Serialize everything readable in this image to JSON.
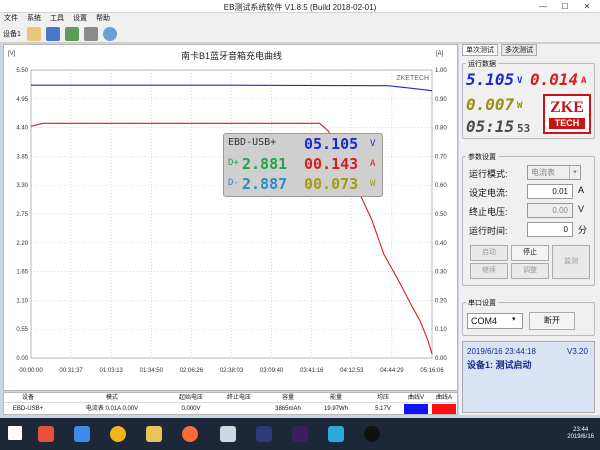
{
  "window": {
    "title": "EB测试系统软件 V1.8.5 (Build 2018-02-01)",
    "minimize": "—",
    "maximize": "☐",
    "close": "✕"
  },
  "menu": [
    "文件",
    "系统",
    "工具",
    "设置",
    "帮助"
  ],
  "toolbar": {
    "device_label": "设备1",
    "icons": [
      "folder-icon",
      "save-icon",
      "image-icon",
      "tools-icon",
      "search-icon"
    ]
  },
  "chart_data": {
    "type": "line",
    "title": "南卡B1蓝牙音箱充电曲线",
    "watermark": "ZKETECH",
    "left_unit": "[V]",
    "right_unit": "[A]",
    "y_left_ticks": [
      "5.50",
      "4.95",
      "4.40",
      "3.85",
      "3.30",
      "2.75",
      "2.20",
      "1.65",
      "1.10",
      "0.55",
      "0.00"
    ],
    "y_right_ticks": [
      "1.00",
      "0.90",
      "0.80",
      "0.70",
      "0.60",
      "0.50",
      "0.40",
      "0.30",
      "0.20",
      "0.10",
      "0.00"
    ],
    "x_ticks": [
      "00:00:00",
      "00:31:37",
      "01:03:13",
      "01:34:50",
      "02:06:26",
      "02:38:03",
      "03:09:40",
      "03:41:16",
      "04:12:53",
      "04:44:29",
      "05:16:06"
    ],
    "ylim_left": [
      0,
      5.5
    ],
    "ylim_right": [
      0,
      1.0
    ],
    "grid": true,
    "series": [
      {
        "axis": "left",
        "color": "#1c2fbf",
        "unit": "V",
        "x": [
          0,
          0.05,
          0.5,
          0.89,
          0.95,
          1.0
        ],
        "y": [
          5.21,
          5.21,
          5.21,
          5.2,
          5.15,
          5.105
        ]
      },
      {
        "axis": "right",
        "color": "#d31f1f",
        "unit": "A",
        "x": [
          0,
          0.03,
          0.5,
          0.72,
          0.74,
          0.76,
          0.8,
          0.85,
          0.88,
          0.92,
          0.95,
          0.97,
          0.99,
          1.0
        ],
        "y": [
          0.805,
          0.815,
          0.815,
          0.815,
          0.79,
          0.75,
          0.63,
          0.48,
          0.36,
          0.26,
          0.18,
          0.13,
          0.06,
          0.014
        ]
      }
    ]
  },
  "overlay": {
    "name": "EBD-USB+",
    "voltage": "05.105",
    "v_unit": "V",
    "dplus_label": "D+",
    "dplus": "2.881",
    "current": "00.143",
    "a_unit": "A",
    "dminus_label": "D-",
    "dminus": "2.887",
    "power": "00.073",
    "w_unit": "W"
  },
  "table": {
    "headers": [
      "设备",
      "模式",
      "起始电压",
      "终止电压",
      "容量",
      "能量",
      "均压",
      "曲线V",
      "曲线A"
    ],
    "row": [
      "EBD-USB+",
      "电流表 0.01A 0.00V",
      "0.000V",
      "",
      "3865mAh",
      "19.97Wh",
      "5.17V",
      "",
      ""
    ],
    "curve_v_color": "#1010ff",
    "curve_a_color": "#ff1010"
  },
  "right": {
    "tabs": [
      "单次测试",
      "多次测试"
    ],
    "run_data_title": "运行数据",
    "voltage": "5.105",
    "v_unit": "V",
    "current": "0.014",
    "a_unit": "A",
    "power": "0.007",
    "w_unit": "W",
    "time": "05:15",
    "time_sec": "53",
    "logo_top": "ZKE",
    "logo_bottom": "TECH",
    "params_title": "参数设置",
    "mode_label": "运行模式:",
    "mode_value": "电流表",
    "set_current_label": "设定电流:",
    "set_current": "0.01",
    "set_current_unit": "A",
    "stop_voltage_label": "终止电压:",
    "stop_voltage": "0.00",
    "stop_voltage_unit": "V",
    "run_time_label": "运行时间:",
    "run_time": "0",
    "run_time_unit": "分",
    "btn_start": "启动",
    "btn_stop": "停止",
    "btn_monitor": "监测",
    "btn_continue": "继续",
    "btn_adjust": "调整",
    "serial_title": "串口设置",
    "port": "COM4",
    "btn_disconnect": "断开",
    "status_time": "2019/6/16 23:44:18",
    "status_version": "V3.20",
    "status_msg": "设备1: 测试启动"
  },
  "taskbar": {
    "time": "23:44",
    "date": "2019/6/16"
  }
}
